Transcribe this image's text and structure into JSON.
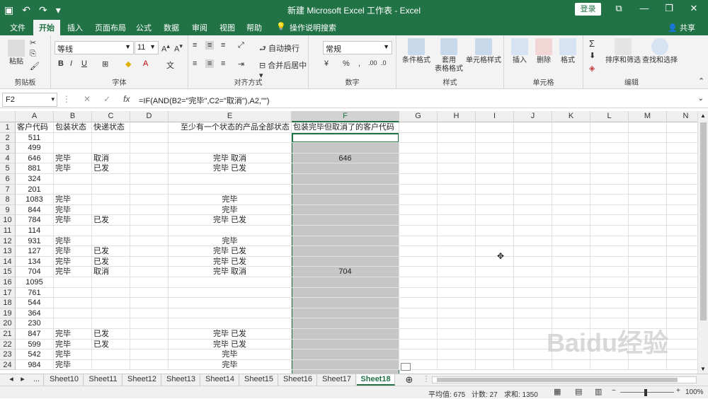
{
  "window": {
    "title": "新建 Microsoft Excel 工作表  -  Excel",
    "login_label": "登录"
  },
  "menu": {
    "tabs": [
      "文件",
      "开始",
      "插入",
      "页面布局",
      "公式",
      "数据",
      "审阅",
      "视图",
      "帮助"
    ],
    "tell_me": "操作说明搜索",
    "share": "共享",
    "active_index": 1
  },
  "ribbon": {
    "clipboard": {
      "paste": "粘贴",
      "group": "剪贴板"
    },
    "font": {
      "name": "等线",
      "size": "11",
      "bold": "B",
      "italic": "I",
      "underline": "U",
      "group": "字体"
    },
    "alignment": {
      "wrap": "自动换行",
      "merge": "合并后居中",
      "group": "对齐方式"
    },
    "number": {
      "format": "常规",
      "group": "数字"
    },
    "styles": {
      "conditional": "条件格式",
      "table_line1": "套用",
      "table_line2": "表格格式",
      "cell_styles": "单元格样式",
      "group": "样式"
    },
    "cells": {
      "insert": "插入",
      "delete": "删除",
      "format": "格式",
      "group": "单元格"
    },
    "editing": {
      "sort": "排序和筛选",
      "find": "查找和选择",
      "group": "编辑"
    }
  },
  "formula_bar": {
    "name_box": "F2",
    "fx": "fx",
    "formula": "=IF(AND(B2=\"完毕\",C2=\"取消\"),A2,\"\")"
  },
  "grid": {
    "columns": [
      "A",
      "B",
      "C",
      "D",
      "E",
      "F",
      "G",
      "H",
      "I",
      "J",
      "K",
      "L",
      "M",
      "N"
    ],
    "selected_column": "F",
    "header_row": [
      "客户代码",
      "包装状态",
      "快递状态",
      "",
      "至少有一个状态的产品全部状态",
      "包装完毕但取消了的客户代码"
    ],
    "rows": [
      {
        "n": "2",
        "a": "511",
        "b": "",
        "c": "",
        "e": "",
        "f": ""
      },
      {
        "n": "3",
        "a": "499",
        "b": "",
        "c": "",
        "e": "",
        "f": ""
      },
      {
        "n": "4",
        "a": "646",
        "b": "完毕",
        "c": "取消",
        "e": "完毕 取消",
        "f": "646"
      },
      {
        "n": "5",
        "a": "881",
        "b": "完毕",
        "c": "已发",
        "e": "完毕 已发",
        "f": ""
      },
      {
        "n": "6",
        "a": "324",
        "b": "",
        "c": "",
        "e": "",
        "f": ""
      },
      {
        "n": "7",
        "a": "201",
        "b": "",
        "c": "",
        "e": "",
        "f": ""
      },
      {
        "n": "8",
        "a": "1083",
        "b": "完毕",
        "c": "",
        "e": "完毕",
        "f": ""
      },
      {
        "n": "9",
        "a": "844",
        "b": "完毕",
        "c": "",
        "e": "完毕",
        "f": ""
      },
      {
        "n": "10",
        "a": "784",
        "b": "完毕",
        "c": "已发",
        "e": "完毕 已发",
        "f": ""
      },
      {
        "n": "11",
        "a": "114",
        "b": "",
        "c": "",
        "e": "",
        "f": ""
      },
      {
        "n": "12",
        "a": "931",
        "b": "完毕",
        "c": "",
        "e": "完毕",
        "f": ""
      },
      {
        "n": "13",
        "a": "127",
        "b": "完毕",
        "c": "已发",
        "e": "完毕 已发",
        "f": ""
      },
      {
        "n": "14",
        "a": "134",
        "b": "完毕",
        "c": "已发",
        "e": "完毕 已发",
        "f": ""
      },
      {
        "n": "15",
        "a": "704",
        "b": "完毕",
        "c": "取消",
        "e": "完毕 取消",
        "f": "704"
      },
      {
        "n": "16",
        "a": "1095",
        "b": "",
        "c": "",
        "e": "",
        "f": ""
      },
      {
        "n": "17",
        "a": "761",
        "b": "",
        "c": "",
        "e": "",
        "f": ""
      },
      {
        "n": "18",
        "a": "544",
        "b": "",
        "c": "",
        "e": "",
        "f": ""
      },
      {
        "n": "19",
        "a": "364",
        "b": "",
        "c": "",
        "e": "",
        "f": ""
      },
      {
        "n": "20",
        "a": "230",
        "b": "",
        "c": "",
        "e": "",
        "f": ""
      },
      {
        "n": "21",
        "a": "847",
        "b": "完毕",
        "c": "已发",
        "e": "完毕 已发",
        "f": ""
      },
      {
        "n": "22",
        "a": "599",
        "b": "完毕",
        "c": "已发",
        "e": "完毕 已发",
        "f": ""
      },
      {
        "n": "23",
        "a": "542",
        "b": "完毕",
        "c": "",
        "e": "完毕",
        "f": ""
      },
      {
        "n": "24",
        "a": "984",
        "b": "完毕",
        "c": "",
        "e": "完毕",
        "f": ""
      }
    ]
  },
  "sheets": {
    "ellipsis": "...",
    "tabs": [
      "Sheet10",
      "Sheet11",
      "Sheet12",
      "Sheet13",
      "Sheet14",
      "Sheet15",
      "Sheet16",
      "Sheet17",
      "Sheet18"
    ],
    "active": "Sheet18"
  },
  "status": {
    "average": "平均值: 675",
    "count": "计数: 27",
    "sum": "求和: 1350",
    "zoom": "100%"
  },
  "watermark": "Baidu经验",
  "colors": {
    "accent": "#217346",
    "selection": "#c6c6c6"
  }
}
